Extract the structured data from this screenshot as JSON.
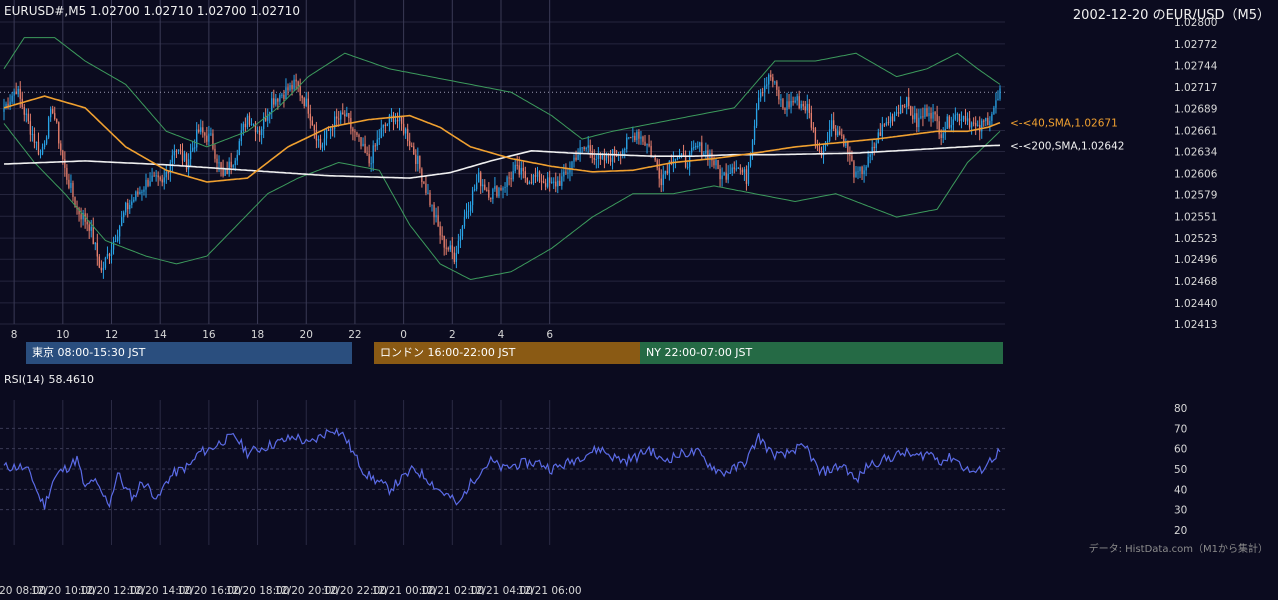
{
  "header": {
    "symbol_info": "EURUSD#,M5 1.02700 1.02710 1.02700 1.02710",
    "date_title": "2002-12-20 のEUR/USD（M5）"
  },
  "sessions": [
    {
      "label": "東京 08:00-15:30 JST",
      "color": "#2a4e7e"
    },
    {
      "label": "ロンドン 16:00-22:00 JST",
      "color": "#8a5a14"
    },
    {
      "label": "NY 22:00-07:00 JST",
      "color": "#256a45"
    }
  ],
  "rsi": {
    "name": "RSI(14)",
    "value": "58.4610"
  },
  "credit": "データ: HistData.com（M1から集計）",
  "colors": {
    "background": "#0b0b1f",
    "up_candle": "#29a3e6",
    "down_candle": "#e8806e",
    "sma40": "#f0a030",
    "sma200": "#f0f0f0",
    "bollinger": "#3c9a5c",
    "rsi_line": "#5b6be6",
    "grid": "#25253d"
  },
  "chart_data": [
    {
      "type": "candlestick",
      "y_ticks": [
        "1.02800",
        "1.02772",
        "1.02744",
        "1.02717",
        "1.02689",
        "1.02661",
        "1.02634",
        "1.02606",
        "1.02579",
        "1.02551",
        "1.02523",
        "1.02496",
        "1.02468",
        "1.02440",
        "1.02413"
      ],
      "ylim": [
        1.02413,
        1.028
      ],
      "x_ticks": [
        "8",
        "10",
        "12",
        "14",
        "16",
        "18",
        "20",
        "22",
        "0",
        "2",
        "4",
        "6"
      ],
      "current_price_line": 1.0271,
      "annotations": [
        {
          "label": "<-<40,SMA,1.02671",
          "series": "sma40",
          "value": 1.02671
        },
        {
          "label": "<-<200,SMA,1.02642",
          "series": "sma200",
          "value": 1.02642
        }
      ],
      "close_anchors": [
        [
          0,
          1.0269
        ],
        [
          6,
          1.02715
        ],
        [
          12,
          1.0267
        ],
        [
          18,
          1.0263
        ],
        [
          24,
          1.0269
        ],
        [
          30,
          1.0261
        ],
        [
          36,
          1.0256
        ],
        [
          42,
          1.0254
        ],
        [
          48,
          1.0248
        ],
        [
          54,
          1.0252
        ],
        [
          60,
          1.0256
        ],
        [
          66,
          1.0258
        ],
        [
          72,
          1.026
        ],
        [
          78,
          1.0259
        ],
        [
          84,
          1.0264
        ],
        [
          90,
          1.0262
        ],
        [
          96,
          1.0266
        ],
        [
          102,
          1.0265
        ],
        [
          108,
          1.026
        ],
        [
          114,
          1.0263
        ],
        [
          120,
          1.0268
        ],
        [
          126,
          1.0266
        ],
        [
          132,
          1.027
        ],
        [
          138,
          1.0271
        ],
        [
          144,
          1.0272
        ],
        [
          150,
          1.0269
        ],
        [
          156,
          1.0264
        ],
        [
          162,
          1.0267
        ],
        [
          168,
          1.0268
        ],
        [
          174,
          1.0265
        ],
        [
          180,
          1.0262
        ],
        [
          186,
          1.0266
        ],
        [
          192,
          1.0268
        ],
        [
          198,
          1.0266
        ],
        [
          204,
          1.0262
        ],
        [
          210,
          1.0257
        ],
        [
          216,
          1.0252
        ],
        [
          222,
          1.025
        ],
        [
          228,
          1.0256
        ],
        [
          234,
          1.026
        ],
        [
          240,
          1.0258
        ],
        [
          246,
          1.0259
        ],
        [
          252,
          1.0261
        ],
        [
          258,
          1.026
        ],
        [
          264,
          1.026
        ],
        [
          270,
          1.0259
        ],
        [
          276,
          1.026
        ],
        [
          282,
          1.0263
        ],
        [
          288,
          1.0264
        ],
        [
          294,
          1.0262
        ],
        [
          300,
          1.0263
        ],
        [
          306,
          1.0264
        ],
        [
          312,
          1.0266
        ],
        [
          318,
          1.0264
        ],
        [
          324,
          1.026
        ],
        [
          330,
          1.0263
        ],
        [
          336,
          1.0262
        ],
        [
          342,
          1.0264
        ],
        [
          348,
          1.0263
        ],
        [
          354,
          1.026
        ],
        [
          360,
          1.0262
        ],
        [
          366,
          1.026
        ],
        [
          372,
          1.0271
        ],
        [
          378,
          1.0273
        ],
        [
          384,
          1.0269
        ],
        [
          390,
          1.027
        ],
        [
          396,
          1.0269
        ],
        [
          402,
          1.0263
        ],
        [
          408,
          1.0267
        ],
        [
          414,
          1.0265
        ],
        [
          420,
          1.026
        ],
        [
          426,
          1.0262
        ],
        [
          432,
          1.0266
        ],
        [
          438,
          1.0268
        ],
        [
          444,
          1.027
        ],
        [
          450,
          1.0267
        ],
        [
          456,
          1.0269
        ],
        [
          462,
          1.0266
        ],
        [
          468,
          1.0268
        ],
        [
          474,
          1.0268
        ],
        [
          480,
          1.0266
        ],
        [
          486,
          1.0268
        ],
        [
          490,
          1.027
        ],
        [
          491,
          1.0271
        ]
      ],
      "sma40_anchors": [
        [
          0,
          1.0269
        ],
        [
          20,
          1.02705
        ],
        [
          40,
          1.0269
        ],
        [
          60,
          1.0264
        ],
        [
          80,
          1.0261
        ],
        [
          100,
          1.02595
        ],
        [
          120,
          1.026
        ],
        [
          140,
          1.0264
        ],
        [
          160,
          1.02665
        ],
        [
          180,
          1.02675
        ],
        [
          200,
          1.0268
        ],
        [
          215,
          1.02665
        ],
        [
          230,
          1.0264
        ],
        [
          250,
          1.02625
        ],
        [
          270,
          1.02615
        ],
        [
          290,
          1.02608
        ],
        [
          310,
          1.0261
        ],
        [
          330,
          1.0262
        ],
        [
          350,
          1.02625
        ],
        [
          370,
          1.02632
        ],
        [
          390,
          1.0264
        ],
        [
          410,
          1.02645
        ],
        [
          430,
          1.0265
        ],
        [
          445,
          1.02655
        ],
        [
          460,
          1.0266
        ],
        [
          475,
          1.0266
        ],
        [
          485,
          1.02665
        ],
        [
          491,
          1.02671
        ]
      ],
      "sma200_anchors": [
        [
          0,
          1.02618
        ],
        [
          40,
          1.02622
        ],
        [
          80,
          1.02617
        ],
        [
          120,
          1.0261
        ],
        [
          160,
          1.02603
        ],
        [
          200,
          1.026
        ],
        [
          220,
          1.02607
        ],
        [
          240,
          1.02622
        ],
        [
          260,
          1.02635
        ],
        [
          280,
          1.02632
        ],
        [
          300,
          1.0263
        ],
        [
          320,
          1.02628
        ],
        [
          340,
          1.02628
        ],
        [
          360,
          1.0263
        ],
        [
          380,
          1.0263
        ],
        [
          400,
          1.02631
        ],
        [
          420,
          1.02632
        ],
        [
          440,
          1.02635
        ],
        [
          460,
          1.02638
        ],
        [
          480,
          1.02641
        ],
        [
          491,
          1.02642
        ]
      ],
      "bb_upper_anchors": [
        [
          0,
          1.0274
        ],
        [
          10,
          1.0278
        ],
        [
          25,
          1.0278
        ],
        [
          40,
          1.0275
        ],
        [
          60,
          1.0272
        ],
        [
          80,
          1.0266
        ],
        [
          100,
          1.0264
        ],
        [
          120,
          1.0266
        ],
        [
          135,
          1.0269
        ],
        [
          150,
          1.0273
        ],
        [
          168,
          1.0276
        ],
        [
          190,
          1.0274
        ],
        [
          210,
          1.0273
        ],
        [
          230,
          1.0272
        ],
        [
          250,
          1.0271
        ],
        [
          270,
          1.0268
        ],
        [
          285,
          1.0265
        ],
        [
          300,
          1.0266
        ],
        [
          320,
          1.0267
        ],
        [
          340,
          1.0268
        ],
        [
          360,
          1.0269
        ],
        [
          380,
          1.0275
        ],
        [
          400,
          1.0275
        ],
        [
          420,
          1.0276
        ],
        [
          440,
          1.0273
        ],
        [
          455,
          1.0274
        ],
        [
          470,
          1.0276
        ],
        [
          480,
          1.0274
        ],
        [
          491,
          1.0272
        ]
      ],
      "bb_lower_anchors": [
        [
          0,
          1.0267
        ],
        [
          15,
          1.0262
        ],
        [
          30,
          1.0258
        ],
        [
          50,
          1.0252
        ],
        [
          70,
          1.025
        ],
        [
          85,
          1.0249
        ],
        [
          100,
          1.025
        ],
        [
          115,
          1.0254
        ],
        [
          130,
          1.0258
        ],
        [
          145,
          1.026
        ],
        [
          165,
          1.0262
        ],
        [
          185,
          1.0261
        ],
        [
          200,
          1.0254
        ],
        [
          215,
          1.0249
        ],
        [
          230,
          1.0247
        ],
        [
          250,
          1.0248
        ],
        [
          270,
          1.0251
        ],
        [
          290,
          1.0255
        ],
        [
          310,
          1.0258
        ],
        [
          330,
          1.0258
        ],
        [
          350,
          1.0259
        ],
        [
          370,
          1.0258
        ],
        [
          390,
          1.0257
        ],
        [
          410,
          1.0258
        ],
        [
          420,
          1.0257
        ],
        [
          440,
          1.0255
        ],
        [
          460,
          1.0256
        ],
        [
          475,
          1.0262
        ],
        [
          491,
          1.0266
        ]
      ]
    },
    {
      "type": "line",
      "name": "RSI(14)",
      "ylim": [
        20,
        80
      ],
      "y_ticks": [
        "80",
        "70",
        "60",
        "50",
        "40",
        "30",
        "20"
      ],
      "grid_levels": [
        70,
        60,
        50,
        40,
        30
      ],
      "anchors": [
        [
          0,
          51
        ],
        [
          8,
          51
        ],
        [
          13,
          48
        ],
        [
          17,
          37
        ],
        [
          20,
          32
        ],
        [
          24,
          44
        ],
        [
          27,
          48
        ],
        [
          33,
          52
        ],
        [
          36,
          55
        ],
        [
          40,
          40
        ],
        [
          44,
          45
        ],
        [
          48,
          38
        ],
        [
          52,
          33
        ],
        [
          56,
          48
        ],
        [
          60,
          40
        ],
        [
          64,
          36
        ],
        [
          68,
          44
        ],
        [
          72,
          40
        ],
        [
          76,
          35
        ],
        [
          80,
          44
        ],
        [
          84,
          48
        ],
        [
          88,
          50
        ],
        [
          92,
          52
        ],
        [
          96,
          58
        ],
        [
          102,
          60
        ],
        [
          108,
          64
        ],
        [
          114,
          66
        ],
        [
          120,
          58
        ],
        [
          126,
          60
        ],
        [
          132,
          62
        ],
        [
          138,
          64
        ],
        [
          144,
          66
        ],
        [
          150,
          62
        ],
        [
          156,
          66
        ],
        [
          162,
          70
        ],
        [
          168,
          66
        ],
        [
          172,
          58
        ],
        [
          178,
          48
        ],
        [
          184,
          44
        ],
        [
          190,
          40
        ],
        [
          196,
          45
        ],
        [
          202,
          50
        ],
        [
          208,
          46
        ],
        [
          214,
          40
        ],
        [
          220,
          36
        ],
        [
          224,
          32
        ],
        [
          228,
          40
        ],
        [
          234,
          48
        ],
        [
          240,
          54
        ],
        [
          246,
          50
        ],
        [
          252,
          52
        ],
        [
          258,
          53
        ],
        [
          264,
          53
        ],
        [
          270,
          50
        ],
        [
          276,
          52
        ],
        [
          282,
          55
        ],
        [
          288,
          58
        ],
        [
          294,
          60
        ],
        [
          300,
          56
        ],
        [
          306,
          54
        ],
        [
          312,
          56
        ],
        [
          318,
          60
        ],
        [
          324,
          54
        ],
        [
          330,
          56
        ],
        [
          336,
          58
        ],
        [
          342,
          58
        ],
        [
          348,
          52
        ],
        [
          354,
          48
        ],
        [
          360,
          50
        ],
        [
          366,
          54
        ],
        [
          372,
          66
        ],
        [
          378,
          58
        ],
        [
          384,
          56
        ],
        [
          390,
          60
        ],
        [
          396,
          60
        ],
        [
          402,
          48
        ],
        [
          408,
          50
        ],
        [
          414,
          52
        ],
        [
          420,
          44
        ],
        [
          426,
          52
        ],
        [
          432,
          54
        ],
        [
          438,
          56
        ],
        [
          444,
          58
        ],
        [
          450,
          56
        ],
        [
          456,
          58
        ],
        [
          462,
          54
        ],
        [
          468,
          56
        ],
        [
          474,
          50
        ],
        [
          480,
          48
        ],
        [
          486,
          54
        ],
        [
          490,
          58
        ],
        [
          491,
          58.461
        ]
      ]
    }
  ],
  "time_axis": {
    "labels": [
      "12/20 08:00",
      "12/20 10:00",
      "12/20 12:00",
      "12/20 14:00",
      "12/20 16:00",
      "12/20 18:00",
      "12/20 20:00",
      "12/20 22:00",
      "12/21 00:00",
      "12/21 02:00",
      "12/21 04:00",
      "12/21 06:00"
    ]
  }
}
